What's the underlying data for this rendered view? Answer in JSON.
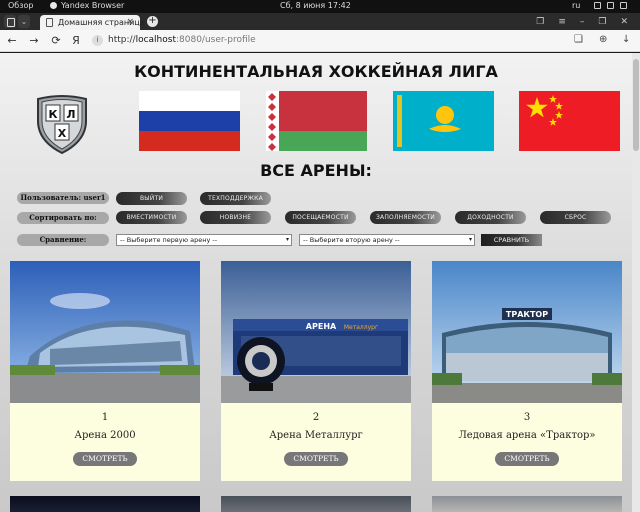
{
  "os": {
    "overview": "Обзор",
    "app_name": "Yandex Browser",
    "clock": "Сб, 8 июня  17:42",
    "lang": "ru"
  },
  "browser": {
    "tab_title": "Домашняя страница",
    "url_host": "localhost",
    "url_rest": ":8080/user-profile",
    "url_scheme": "http://"
  },
  "page": {
    "title": "КОНТИНЕНТАЛЬНАЯ ХОККЕЙНАЯ ЛИГА",
    "section_title": "ВСЕ АРЕНЫ:",
    "user_label": "Пользователь: user1",
    "logout": "ВЫЙТИ",
    "support": "ТЕХПОДДЕРЖКА",
    "sort_label": "Сортировать по:",
    "sort_buttons": [
      "ВМЕСТИМОСТИ",
      "НОВИЗНЕ",
      "ПОСЕЩАЕМОСТИ",
      "ЗАПОЛНЯЕМОСТИ",
      "ДОХОДНОСТИ",
      "СБРОС"
    ],
    "compare_label": "Сравнение:",
    "select_first": "-- Выберите первую арену --",
    "select_second": "-- Выберите вторую арену --",
    "compare_button": "СРАВНИТЬ"
  },
  "logo_letters": [
    "К",
    "Х",
    "Л"
  ],
  "arenas": [
    {
      "number": "1",
      "name": "Арена 2000",
      "button": "СМОТРЕТЬ"
    },
    {
      "number": "2",
      "name": "Арена Металлург",
      "button": "СМОТРЕТЬ"
    },
    {
      "number": "3",
      "name": "Ледовая арена «Трактор»",
      "button": "СМОТРЕТЬ"
    }
  ],
  "photo_signs": {
    "arena2": "АРЕНА",
    "arena2_b": "Металлург",
    "arena3": "ТРАКТОР"
  },
  "colors": {
    "card_bg": "#fdfde0",
    "button_gray": "#777777",
    "label_gray": "#a8a8a8"
  }
}
